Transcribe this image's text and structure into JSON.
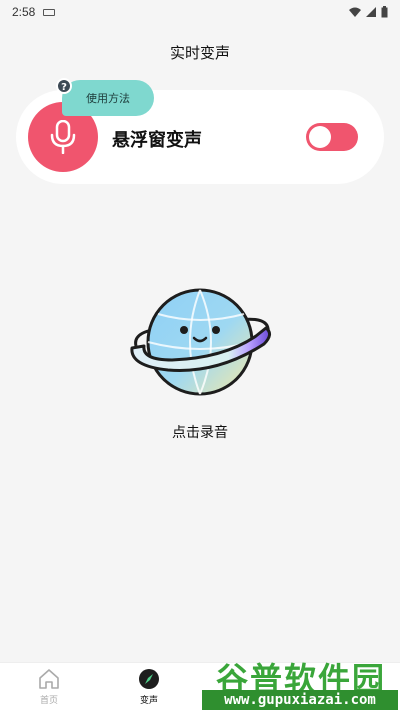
{
  "status": {
    "time": "2:58"
  },
  "title": "实时变声",
  "float_card": {
    "label": "悬浮窗变声",
    "help_label": "使用方法",
    "help_icon_text": "?",
    "toggle_on": true,
    "accent": "#f0556e",
    "help_bg": "#7fd8cf"
  },
  "record": {
    "label": "点击录音"
  },
  "nav": {
    "items": [
      {
        "label": "首页",
        "icon": "home-icon",
        "active": false
      },
      {
        "label": "变声",
        "icon": "compass-icon",
        "active": true
      }
    ]
  },
  "watermark": {
    "brand": "谷普软件园",
    "url": "www.gupuxiazai.com"
  }
}
